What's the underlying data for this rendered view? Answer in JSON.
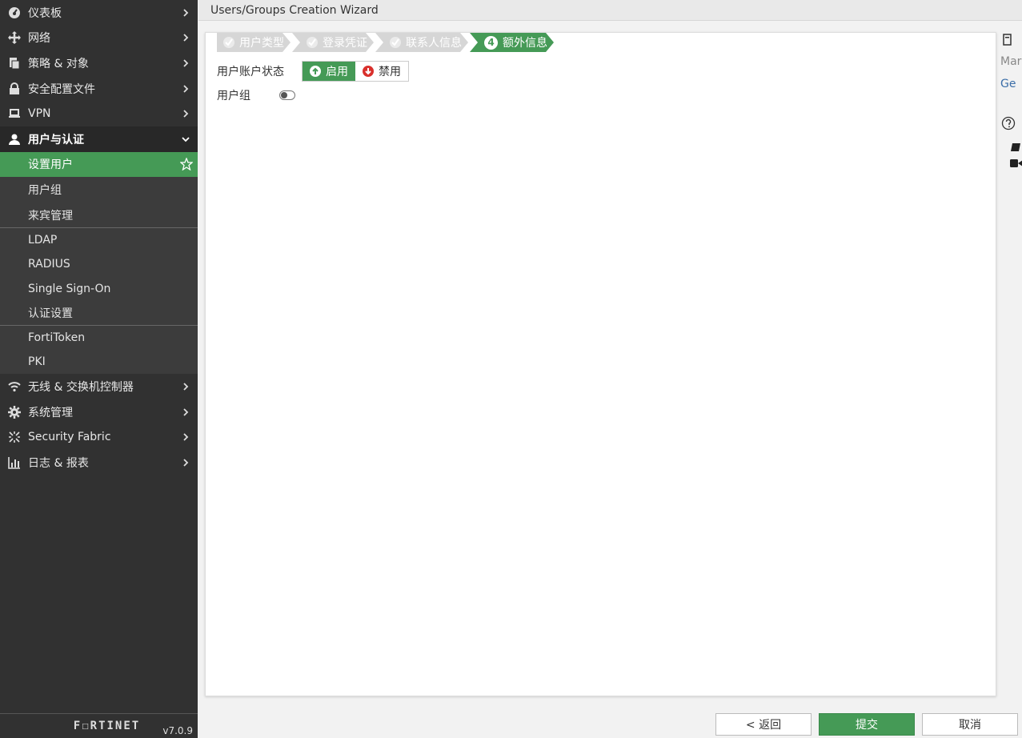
{
  "sidebar": {
    "items": [
      {
        "label": "仪表板",
        "icon": "dashboard-icon"
      },
      {
        "label": "网络",
        "icon": "network-icon"
      },
      {
        "label": "策略 & 对象",
        "icon": "policy-icon"
      },
      {
        "label": "安全配置文件",
        "icon": "lock-icon"
      },
      {
        "label": "VPN",
        "icon": "laptop-icon"
      },
      {
        "label": "用户与认证",
        "icon": "user-icon"
      }
    ],
    "sub_items": [
      {
        "label": "设置用户"
      },
      {
        "label": "用户组"
      },
      {
        "label": "来宾管理"
      },
      {
        "label": "LDAP"
      },
      {
        "label": "RADIUS"
      },
      {
        "label": "Single Sign-On"
      },
      {
        "label": "认证设置"
      },
      {
        "label": "FortiToken"
      },
      {
        "label": "PKI"
      }
    ],
    "items_after": [
      {
        "label": "无线 & 交换机控制器",
        "icon": "wifi-icon"
      },
      {
        "label": "系统管理",
        "icon": "gear-icon"
      },
      {
        "label": "Security Fabric",
        "icon": "fabric-icon"
      },
      {
        "label": "日志 & 报表",
        "icon": "chart-icon"
      }
    ],
    "brand": "F☐RTINET",
    "version": "v7.0.9"
  },
  "header": {
    "title": "Users/Groups Creation Wizard"
  },
  "wizard": {
    "steps": [
      {
        "label": "用户类型",
        "state": "done"
      },
      {
        "label": "登录凭证",
        "state": "done"
      },
      {
        "label": "联系人信息",
        "state": "done"
      },
      {
        "label": "额外信息",
        "state": "current",
        "number": "4"
      }
    ]
  },
  "form": {
    "status_label": "用户账户状态",
    "enable_label": "启用",
    "disable_label": "禁用",
    "group_label": "用户组"
  },
  "right_panel": {
    "line1": "Mar",
    "line2": "Ge"
  },
  "footer": {
    "back_label": "< 返回",
    "submit_label": "提交",
    "cancel_label": "取消"
  },
  "colors": {
    "accent": "#459a56",
    "sidebar_bg": "#313131"
  }
}
